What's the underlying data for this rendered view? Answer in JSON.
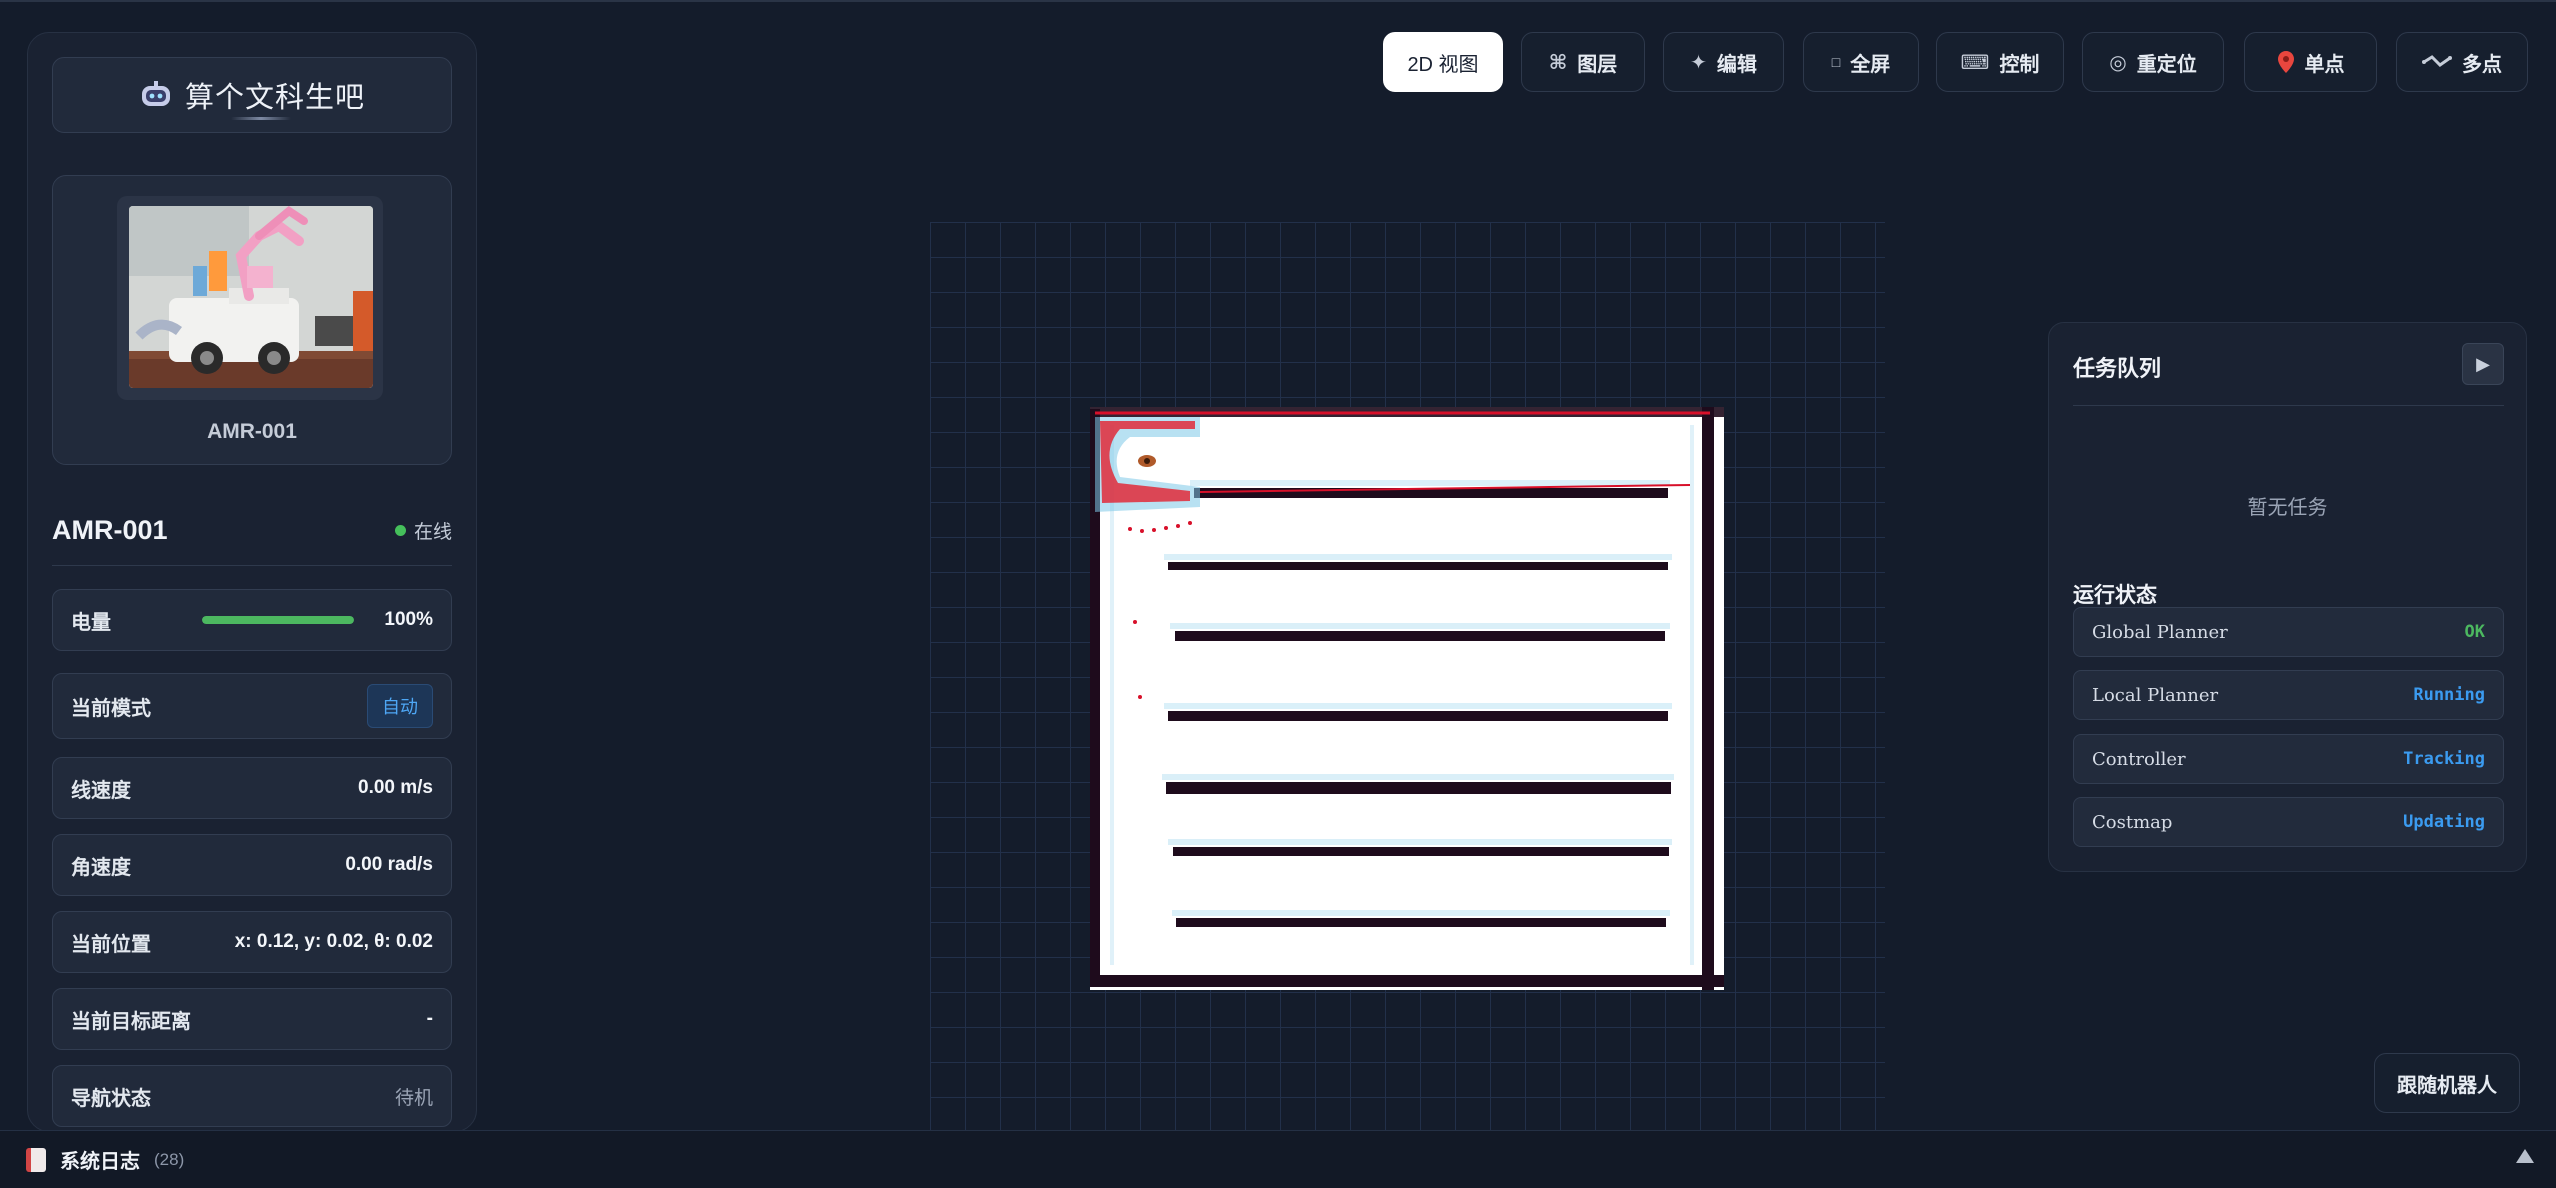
{
  "brand": {
    "title": "算个文科生吧",
    "icon": "robot-face-icon"
  },
  "robot": {
    "card_name": "AMR-001",
    "name": "AMR-001",
    "status": "在线",
    "status_color": "#45c05b"
  },
  "stats": {
    "battery": {
      "label": "电量",
      "value": "100%",
      "level": 1.0
    },
    "mode": {
      "label": "当前模式",
      "value": "自动"
    },
    "linear_speed": {
      "label": "线速度",
      "value": "0.00 m/s"
    },
    "angular_speed": {
      "label": "角速度",
      "value": "0.00 rad/s"
    },
    "position": {
      "label": "当前位置",
      "value": "x: 0.12, y: 0.02, θ: 0.02"
    },
    "target_distance": {
      "label": "当前目标距离",
      "value": "-"
    },
    "nav_status": {
      "label": "导航状态",
      "value": "待机"
    }
  },
  "toolbar": {
    "view2d": "2D 视图",
    "layers": "图层",
    "edit": "编辑",
    "fullscreen": "全屏",
    "control": "控制",
    "relocate": "重定位",
    "single_point": "单点",
    "multi_point": "多点"
  },
  "tasks": {
    "title": "任务队列",
    "empty": "暂无任务",
    "runtime_title": "运行状态",
    "components": [
      {
        "name": "Global Planner",
        "state": "OK",
        "color": "#4cb860"
      },
      {
        "name": "Local Planner",
        "state": "Running",
        "color": "#3b9bf0"
      },
      {
        "name": "Controller",
        "state": "Tracking",
        "color": "#3b9bf0"
      },
      {
        "name": "Costmap",
        "state": "Updating",
        "color": "#3b9bf0"
      }
    ]
  },
  "follow_button": "跟随机器人",
  "log": {
    "label": "系统日志",
    "count": "(28)"
  },
  "colors": {
    "accent": "#3b9bf0",
    "online": "#45c05b",
    "background": "#141c2b"
  }
}
